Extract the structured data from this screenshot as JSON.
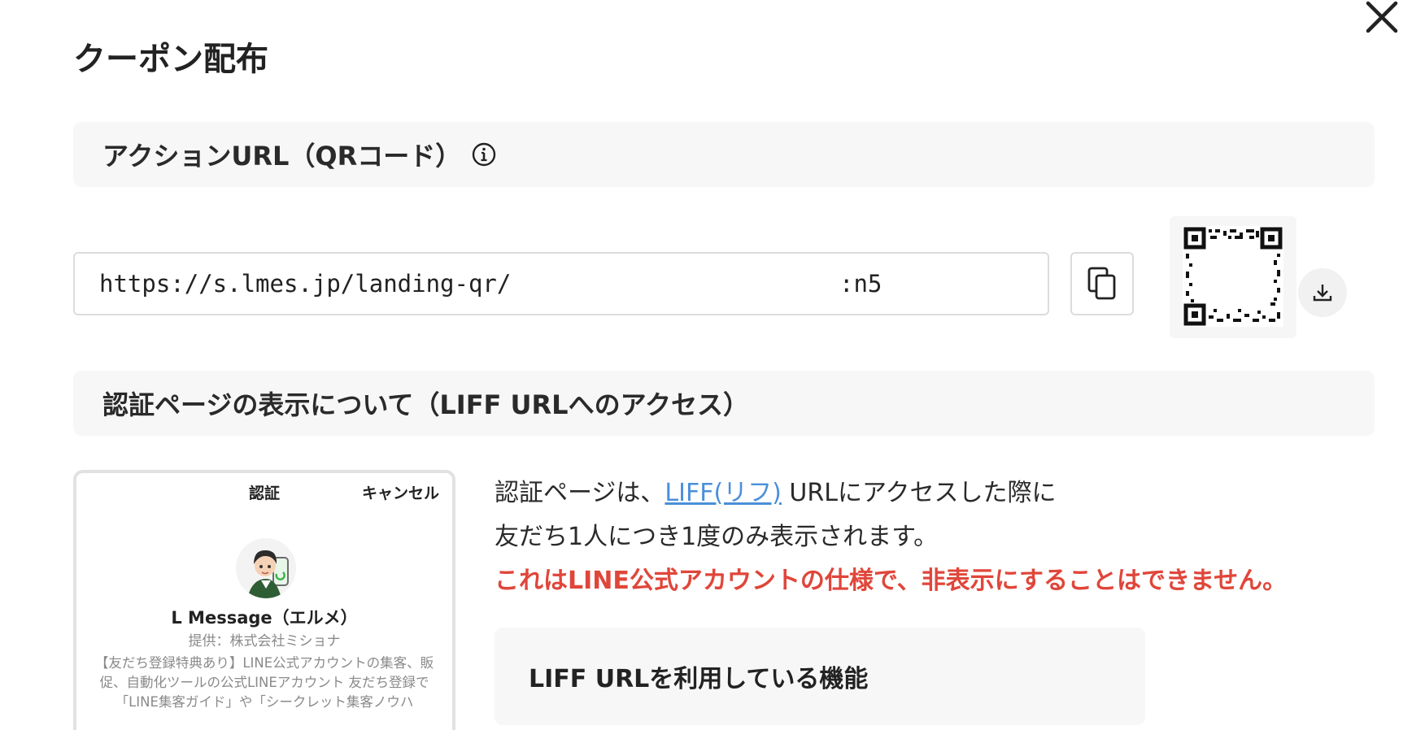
{
  "page": {
    "title": "クーポン配布"
  },
  "action_url_section": {
    "title": "アクションURL（QRコード）",
    "url_value": "https://s.lmes.jp/landing-qr/",
    "url_suffix": ":n5",
    "info_icon": "info-circle-icon",
    "copy_icon": "copy-icon",
    "download_icon": "download-icon",
    "qr_icon": "qr-code"
  },
  "auth_section": {
    "title": "認証ページの表示について（LIFF URLへのアクセス）",
    "description_prefix": "認証ページは、",
    "liff_link": "LIFF(リフ)",
    "description_suffix": " URLにアクセスした際に",
    "description_line2": "友だち1人につき1度のみ表示されます。",
    "warning": "これはLINE公式アカウントの仕様で、非表示にすることはできません。",
    "link_color": "#4a90d9",
    "warning_color": "#e0463a"
  },
  "preview": {
    "auth_label": "認証",
    "cancel_label": "キャンセル",
    "app_name": "L Message（エルメ）",
    "provider": "提供：株式会社ミショナ",
    "description": "【友だち登録特典あり】LINE公式アカウントの集客、販促、自動化ツールの公式LINEアカウント 友だち登録で「LINE集客ガイド」や「シークレット集客ノウハ"
  },
  "feature_box": {
    "title": "LIFF URLを利用している機能"
  },
  "close": {
    "icon": "close-icon"
  }
}
